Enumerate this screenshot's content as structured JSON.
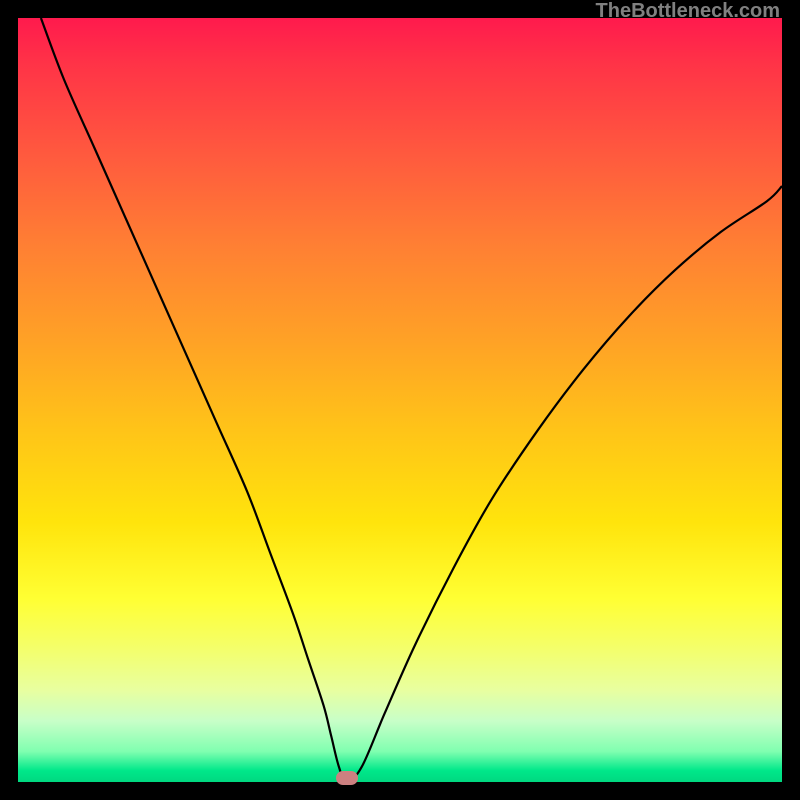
{
  "watermark": "TheBottleneck.com",
  "chart_data": {
    "type": "line",
    "title": "",
    "xlabel": "",
    "ylabel": "",
    "xlim": [
      0,
      100
    ],
    "ylim": [
      0,
      100
    ],
    "series": [
      {
        "name": "bottleneck-curve",
        "x": [
          3,
          6,
          10,
          14,
          18,
          22,
          26,
          30,
          33,
          36,
          38,
          40,
          41,
          42,
          43,
          45,
          48,
          52,
          57,
          62,
          68,
          74,
          80,
          86,
          92,
          98,
          100
        ],
        "values": [
          100,
          92,
          83,
          74,
          65,
          56,
          47,
          38,
          30,
          22,
          16,
          10,
          6,
          2,
          0,
          2,
          9,
          18,
          28,
          37,
          46,
          54,
          61,
          67,
          72,
          76,
          78
        ]
      }
    ],
    "marker": {
      "x": 43,
      "y": 0.5
    },
    "gradient_stops": [
      {
        "pos": 0,
        "color": "#ff1a4d"
      },
      {
        "pos": 50,
        "color": "#ffc418"
      },
      {
        "pos": 80,
        "color": "#ffff33"
      },
      {
        "pos": 100,
        "color": "#00d880"
      }
    ]
  }
}
